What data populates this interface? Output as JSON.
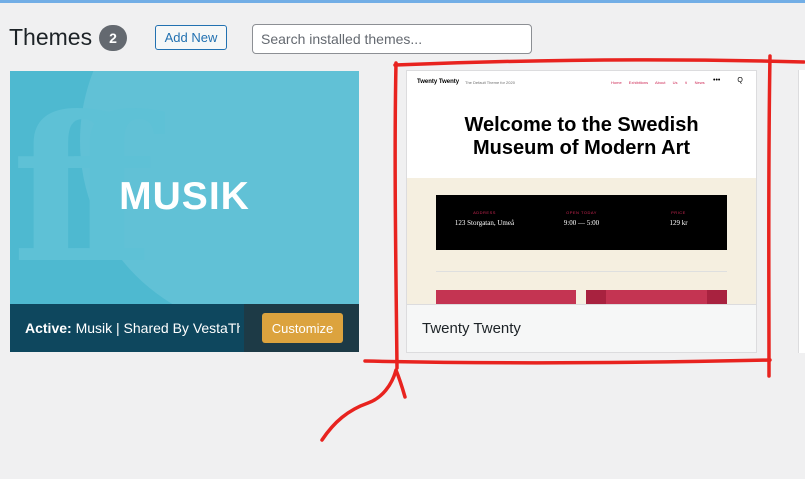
{
  "header": {
    "title": "Themes",
    "count": "2",
    "add_new_label": "Add New"
  },
  "search": {
    "placeholder": "Search installed themes..."
  },
  "themes": [
    {
      "screenshot_text": "MUSIK",
      "screenshot_glyph": "ff",
      "active_prefix": "Active:",
      "active_name": " Musik | Shared By VestaThemes.com",
      "customize_label": "Customize"
    },
    {
      "name": "Twenty Twenty",
      "preview": {
        "site_title": "Twenty Twenty",
        "site_description": "The Default Theme for 2020",
        "menu": "Home Exhibitions About Us ∨ News",
        "icon_menu": "•••",
        "icon_search": "Q",
        "headline_line1": "Welcome to the Swedish",
        "headline_line2": "Museum of Modern Art",
        "info": [
          {
            "label": "ADDRESS",
            "value": "123 Storgatan, Umeå"
          },
          {
            "label": "OPEN TODAY",
            "value": "9:00 — 5:00"
          },
          {
            "label": "PRICE",
            "value": "129 kr"
          }
        ]
      }
    }
  ],
  "colors": {
    "annotation": "#e8231f",
    "accent": "#2271b1",
    "customize": "#dca33e",
    "active_bar": "#0e475e"
  }
}
